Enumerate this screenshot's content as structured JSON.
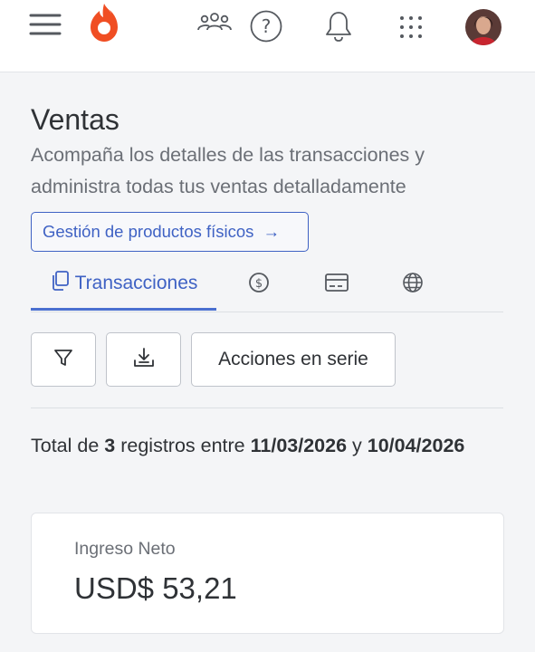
{
  "header": {
    "icons": [
      "menu-icon",
      "hotmart-logo",
      "people-icon",
      "help-icon",
      "bell-icon",
      "apps-grid-icon",
      "avatar"
    ],
    "brand_color": "#f04e23"
  },
  "page": {
    "title": "Ventas",
    "description": "Acompaña los detalles de las transacciones y administra todas tus ventas detalladamente"
  },
  "products_button": {
    "label": "Gestión de productos físicos",
    "arrow": "→"
  },
  "tabs": [
    {
      "label": "Transacciones",
      "icon": "copy-icon",
      "active": true
    },
    {
      "label": "",
      "icon": "dollar-coin-icon",
      "active": false
    },
    {
      "label": "",
      "icon": "credit-card-icon",
      "active": false
    },
    {
      "label": "",
      "icon": "globe-icon",
      "active": false
    }
  ],
  "actions": {
    "filter_icon": "filter-icon",
    "download_icon": "download-icon",
    "bulk_label": "Acciones en serie"
  },
  "summary": {
    "prefix": "Total de ",
    "count": "3",
    "middle": " registros entre ",
    "date_from": "11/03/2026",
    "connector": " y ",
    "date_to": "10/04/2026"
  },
  "net_income": {
    "label": "Ingreso Neto",
    "value": "USD$ 53,21"
  },
  "colors": {
    "accent": "#3f62c4",
    "text": "#2f3236",
    "muted": "#6b6f76"
  }
}
